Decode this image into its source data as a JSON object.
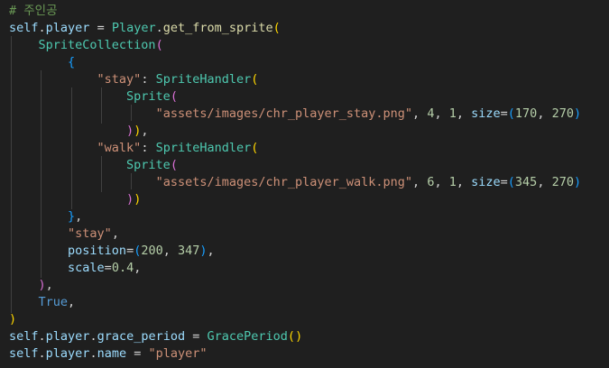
{
  "editor": {
    "theme": {
      "background": "#1f1f1f"
    },
    "lines": [
      [
        {
          "t": "# 주인공",
          "c": "comment"
        }
      ],
      [
        {
          "t": "self",
          "c": "var"
        },
        {
          "t": ".",
          "c": "op"
        },
        {
          "t": "player",
          "c": "var"
        },
        {
          "t": " = ",
          "c": "op"
        },
        {
          "t": "Player",
          "c": "class"
        },
        {
          "t": ".",
          "c": "op"
        },
        {
          "t": "get_from_sprite",
          "c": "func"
        },
        {
          "t": "(",
          "c": "b1"
        }
      ],
      [
        {
          "t": "    ",
          "c": "op"
        },
        {
          "t": "SpriteCollection",
          "c": "class"
        },
        {
          "t": "(",
          "c": "b2"
        }
      ],
      [
        {
          "t": "        ",
          "c": "op"
        },
        {
          "t": "{",
          "c": "b3"
        }
      ],
      [
        {
          "t": "            ",
          "c": "op"
        },
        {
          "t": "\"stay\"",
          "c": "str"
        },
        {
          "t": ": ",
          "c": "op"
        },
        {
          "t": "SpriteHandler",
          "c": "class"
        },
        {
          "t": "(",
          "c": "b1"
        }
      ],
      [
        {
          "t": "                ",
          "c": "op"
        },
        {
          "t": "Sprite",
          "c": "class"
        },
        {
          "t": "(",
          "c": "b2"
        }
      ],
      [
        {
          "t": "                    ",
          "c": "op"
        },
        {
          "t": "\"assets/images/chr_player_stay.png\"",
          "c": "str"
        },
        {
          "t": ", ",
          "c": "op"
        },
        {
          "t": "4",
          "c": "num"
        },
        {
          "t": ", ",
          "c": "op"
        },
        {
          "t": "1",
          "c": "num"
        },
        {
          "t": ", ",
          "c": "op"
        },
        {
          "t": "size",
          "c": "var"
        },
        {
          "t": "=",
          "c": "op"
        },
        {
          "t": "(",
          "c": "b3"
        },
        {
          "t": "170",
          "c": "num"
        },
        {
          "t": ", ",
          "c": "op"
        },
        {
          "t": "270",
          "c": "num"
        },
        {
          "t": ")",
          "c": "b3"
        }
      ],
      [
        {
          "t": "                ",
          "c": "op"
        },
        {
          "t": ")",
          "c": "b2"
        },
        {
          "t": ")",
          "c": "b1"
        },
        {
          "t": ",",
          "c": "op"
        }
      ],
      [
        {
          "t": "            ",
          "c": "op"
        },
        {
          "t": "\"walk\"",
          "c": "str"
        },
        {
          "t": ": ",
          "c": "op"
        },
        {
          "t": "SpriteHandler",
          "c": "class"
        },
        {
          "t": "(",
          "c": "b1"
        }
      ],
      [
        {
          "t": "                ",
          "c": "op"
        },
        {
          "t": "Sprite",
          "c": "class"
        },
        {
          "t": "(",
          "c": "b2"
        }
      ],
      [
        {
          "t": "                    ",
          "c": "op"
        },
        {
          "t": "\"assets/images/chr_player_walk.png\"",
          "c": "str"
        },
        {
          "t": ", ",
          "c": "op"
        },
        {
          "t": "6",
          "c": "num"
        },
        {
          "t": ", ",
          "c": "op"
        },
        {
          "t": "1",
          "c": "num"
        },
        {
          "t": ", ",
          "c": "op"
        },
        {
          "t": "size",
          "c": "var"
        },
        {
          "t": "=",
          "c": "op"
        },
        {
          "t": "(",
          "c": "b3"
        },
        {
          "t": "345",
          "c": "num"
        },
        {
          "t": ", ",
          "c": "op"
        },
        {
          "t": "270",
          "c": "num"
        },
        {
          "t": ")",
          "c": "b3"
        }
      ],
      [
        {
          "t": "                ",
          "c": "op"
        },
        {
          "t": ")",
          "c": "b2"
        },
        {
          "t": ")",
          "c": "b1"
        }
      ],
      [
        {
          "t": "        ",
          "c": "op"
        },
        {
          "t": "}",
          "c": "b3"
        },
        {
          "t": ",",
          "c": "op"
        }
      ],
      [
        {
          "t": "        ",
          "c": "op"
        },
        {
          "t": "\"stay\"",
          "c": "str"
        },
        {
          "t": ",",
          "c": "op"
        }
      ],
      [
        {
          "t": "        ",
          "c": "op"
        },
        {
          "t": "position",
          "c": "var"
        },
        {
          "t": "=",
          "c": "op"
        },
        {
          "t": "(",
          "c": "b3"
        },
        {
          "t": "200",
          "c": "num"
        },
        {
          "t": ", ",
          "c": "op"
        },
        {
          "t": "347",
          "c": "num"
        },
        {
          "t": ")",
          "c": "b3"
        },
        {
          "t": ",",
          "c": "op"
        }
      ],
      [
        {
          "t": "        ",
          "c": "op"
        },
        {
          "t": "scale",
          "c": "var"
        },
        {
          "t": "=",
          "c": "op"
        },
        {
          "t": "0.4",
          "c": "num"
        },
        {
          "t": ",",
          "c": "op"
        }
      ],
      [
        {
          "t": "    ",
          "c": "op"
        },
        {
          "t": ")",
          "c": "b2"
        },
        {
          "t": ",",
          "c": "op"
        }
      ],
      [
        {
          "t": "    ",
          "c": "op"
        },
        {
          "t": "True",
          "c": "kw"
        },
        {
          "t": ",",
          "c": "op"
        }
      ],
      [
        {
          "t": ")",
          "c": "b1"
        }
      ],
      [
        {
          "t": "self",
          "c": "var"
        },
        {
          "t": ".",
          "c": "op"
        },
        {
          "t": "player",
          "c": "var"
        },
        {
          "t": ".",
          "c": "op"
        },
        {
          "t": "grace_period",
          "c": "var"
        },
        {
          "t": " = ",
          "c": "op"
        },
        {
          "t": "GracePeriod",
          "c": "class"
        },
        {
          "t": "(",
          "c": "b1"
        },
        {
          "t": ")",
          "c": "b1"
        }
      ],
      [
        {
          "t": "self",
          "c": "var"
        },
        {
          "t": ".",
          "c": "op"
        },
        {
          "t": "player",
          "c": "var"
        },
        {
          "t": ".",
          "c": "op"
        },
        {
          "t": "name",
          "c": "var"
        },
        {
          "t": " = ",
          "c": "op"
        },
        {
          "t": "\"player\"",
          "c": "str"
        }
      ]
    ]
  }
}
